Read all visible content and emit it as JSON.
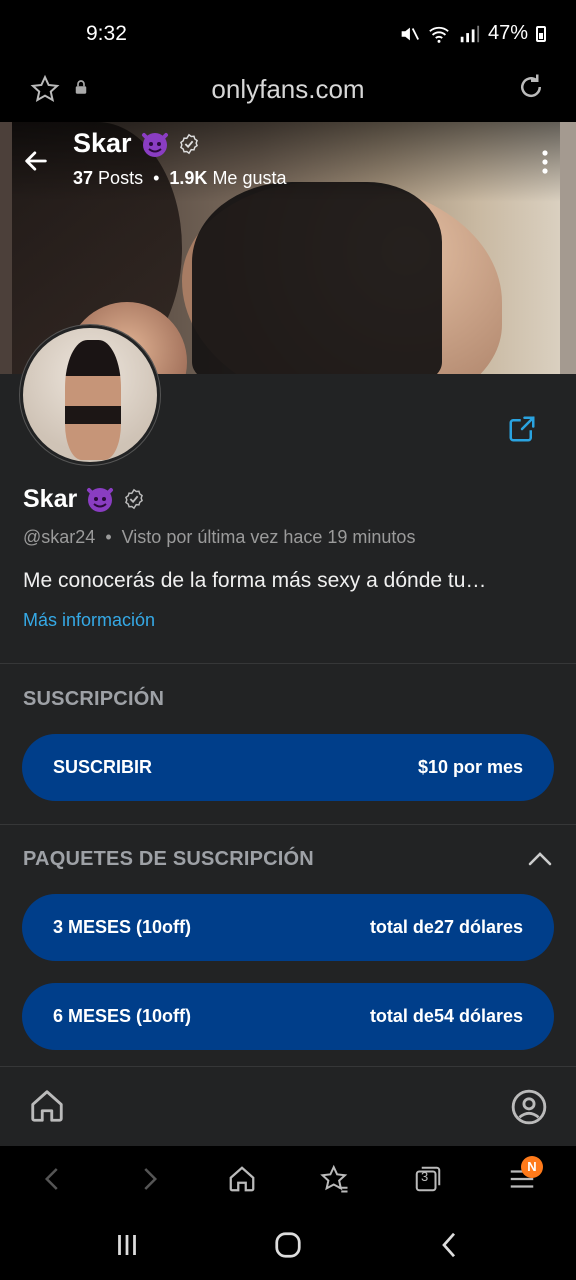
{
  "status_bar": {
    "time": "9:32",
    "battery": "47%"
  },
  "browser": {
    "url": "onlyfans.com"
  },
  "header": {
    "name": "Skar",
    "posts": "37",
    "posts_label": "Posts",
    "likes": "1.9K",
    "likes_label": "Me gusta"
  },
  "profile": {
    "name": "Skar",
    "handle": "@skar24",
    "last_seen": "Visto por última vez hace 19 minutos",
    "bio": "Me conocerás de la forma más sexy a dónde tu…",
    "more_info": "Más información"
  },
  "subscription": {
    "title": "SUSCRIPCIÓN",
    "button_label": "SUSCRIBIR",
    "price": "$10 por mes"
  },
  "bundles": {
    "title": "PAQUETES DE SUSCRIPCIÓN",
    "items": [
      {
        "label": "3 MESES (10off)",
        "total": "total de27 dólares"
      },
      {
        "label": "6 MESES (10off)",
        "total": "total de54 dólares"
      }
    ]
  },
  "browser_toolbar": {
    "tabs_count": "3",
    "menu_badge": "N"
  },
  "colors": {
    "panel_bg": "#222324",
    "button_blue": "#003e8a",
    "link_blue": "#35a9e6",
    "badge_orange": "#ff7a1a"
  }
}
